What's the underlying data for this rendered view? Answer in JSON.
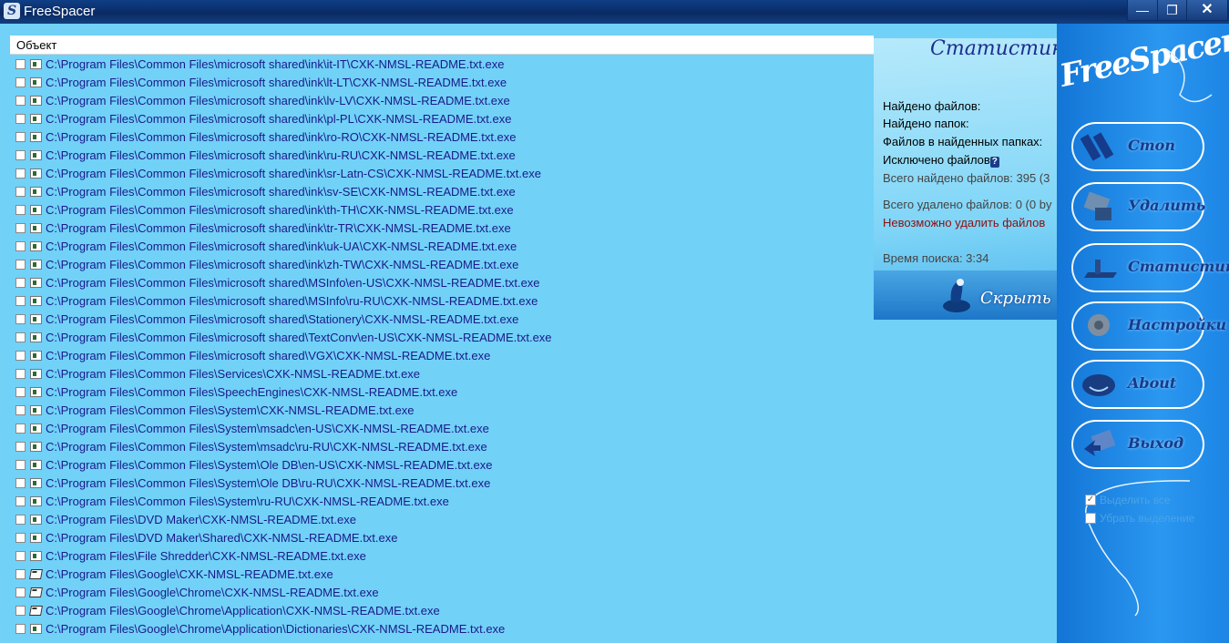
{
  "window": {
    "title": "FreeSpacer",
    "icon": "freespacer-icon",
    "min": "—",
    "max": "❐",
    "close": "✕"
  },
  "list": {
    "header": "Объект",
    "rows": [
      {
        "path": "C:\\Program Files\\Common Files\\microsoft shared\\ink\\it-IT\\CXK-NMSL-README.txt.exe",
        "icon": "file"
      },
      {
        "path": "C:\\Program Files\\Common Files\\microsoft shared\\ink\\lt-LT\\CXK-NMSL-README.txt.exe",
        "icon": "file"
      },
      {
        "path": "C:\\Program Files\\Common Files\\microsoft shared\\ink\\lv-LV\\CXK-NMSL-README.txt.exe",
        "icon": "file"
      },
      {
        "path": "C:\\Program Files\\Common Files\\microsoft shared\\ink\\pl-PL\\CXK-NMSL-README.txt.exe",
        "icon": "file"
      },
      {
        "path": "C:\\Program Files\\Common Files\\microsoft shared\\ink\\ro-RO\\CXK-NMSL-README.txt.exe",
        "icon": "file"
      },
      {
        "path": "C:\\Program Files\\Common Files\\microsoft shared\\ink\\ru-RU\\CXK-NMSL-README.txt.exe",
        "icon": "file"
      },
      {
        "path": "C:\\Program Files\\Common Files\\microsoft shared\\ink\\sr-Latn-CS\\CXK-NMSL-README.txt.exe",
        "icon": "file"
      },
      {
        "path": "C:\\Program Files\\Common Files\\microsoft shared\\ink\\sv-SE\\CXK-NMSL-README.txt.exe",
        "icon": "file"
      },
      {
        "path": "C:\\Program Files\\Common Files\\microsoft shared\\ink\\th-TH\\CXK-NMSL-README.txt.exe",
        "icon": "file"
      },
      {
        "path": "C:\\Program Files\\Common Files\\microsoft shared\\ink\\tr-TR\\CXK-NMSL-README.txt.exe",
        "icon": "file"
      },
      {
        "path": "C:\\Program Files\\Common Files\\microsoft shared\\ink\\uk-UA\\CXK-NMSL-README.txt.exe",
        "icon": "file"
      },
      {
        "path": "C:\\Program Files\\Common Files\\microsoft shared\\ink\\zh-TW\\CXK-NMSL-README.txt.exe",
        "icon": "file"
      },
      {
        "path": "C:\\Program Files\\Common Files\\microsoft shared\\MSInfo\\en-US\\CXK-NMSL-README.txt.exe",
        "icon": "file"
      },
      {
        "path": "C:\\Program Files\\Common Files\\microsoft shared\\MSInfo\\ru-RU\\CXK-NMSL-README.txt.exe",
        "icon": "file"
      },
      {
        "path": "C:\\Program Files\\Common Files\\microsoft shared\\Stationery\\CXK-NMSL-README.txt.exe",
        "icon": "file"
      },
      {
        "path": "C:\\Program Files\\Common Files\\microsoft shared\\TextConv\\en-US\\CXK-NMSL-README.txt.exe",
        "icon": "file"
      },
      {
        "path": "C:\\Program Files\\Common Files\\microsoft shared\\VGX\\CXK-NMSL-README.txt.exe",
        "icon": "file"
      },
      {
        "path": "C:\\Program Files\\Common Files\\Services\\CXK-NMSL-README.txt.exe",
        "icon": "file"
      },
      {
        "path": "C:\\Program Files\\Common Files\\SpeechEngines\\CXK-NMSL-README.txt.exe",
        "icon": "file"
      },
      {
        "path": "C:\\Program Files\\Common Files\\System\\CXK-NMSL-README.txt.exe",
        "icon": "file"
      },
      {
        "path": "C:\\Program Files\\Common Files\\System\\msadc\\en-US\\CXK-NMSL-README.txt.exe",
        "icon": "file"
      },
      {
        "path": "C:\\Program Files\\Common Files\\System\\msadc\\ru-RU\\CXK-NMSL-README.txt.exe",
        "icon": "file"
      },
      {
        "path": "C:\\Program Files\\Common Files\\System\\Ole DB\\en-US\\CXK-NMSL-README.txt.exe",
        "icon": "file"
      },
      {
        "path": "C:\\Program Files\\Common Files\\System\\Ole DB\\ru-RU\\CXK-NMSL-README.txt.exe",
        "icon": "file"
      },
      {
        "path": "C:\\Program Files\\Common Files\\System\\ru-RU\\CXK-NMSL-README.txt.exe",
        "icon": "file"
      },
      {
        "path": "C:\\Program Files\\DVD Maker\\CXK-NMSL-README.txt.exe",
        "icon": "file"
      },
      {
        "path": "C:\\Program Files\\DVD Maker\\Shared\\CXK-NMSL-README.txt.exe",
        "icon": "file"
      },
      {
        "path": "C:\\Program Files\\File Shredder\\CXK-NMSL-README.txt.exe",
        "icon": "file"
      },
      {
        "path": "C:\\Program Files\\Google\\CXK-NMSL-README.txt.exe",
        "icon": "folder"
      },
      {
        "path": "C:\\Program Files\\Google\\Chrome\\CXK-NMSL-README.txt.exe",
        "icon": "folder"
      },
      {
        "path": "C:\\Program Files\\Google\\Chrome\\Application\\CXK-NMSL-README.txt.exe",
        "icon": "folder"
      },
      {
        "path": "C:\\Program Files\\Google\\Chrome\\Application\\Dictionaries\\CXK-NMSL-README.txt.exe",
        "icon": "file"
      }
    ]
  },
  "stats": {
    "title": "Статистика",
    "files_found": "Найдено файлов:",
    "folders_found": "Найдено папок:",
    "files_in_folders": "Файлов в найденных папках:",
    "excluded": "Исключено файлов",
    "total_found": "Всего найдено файлов: 395 (3",
    "total_deleted": "Всего удалено файлов: 0 (0 by",
    "cannot_delete": "Невозможно удалить файлов",
    "search_time": "Время поиска: 3:34",
    "hide_button": "Скрыть"
  },
  "sidebar": {
    "logo": "FreeSpacer",
    "buttons": [
      {
        "label": "Стоп",
        "icon": "stop-icon"
      },
      {
        "label": "Удалить",
        "icon": "delete-icon"
      },
      {
        "label": "Статистика",
        "icon": "statistics-icon"
      },
      {
        "label": "Настройки",
        "icon": "settings-icon"
      },
      {
        "label": "About",
        "icon": "about-icon"
      },
      {
        "label": "Выход",
        "icon": "exit-icon"
      }
    ],
    "options": [
      {
        "label": "Выделить все",
        "checked": true
      },
      {
        "label": "Убрать выделение",
        "checked": false
      }
    ]
  }
}
